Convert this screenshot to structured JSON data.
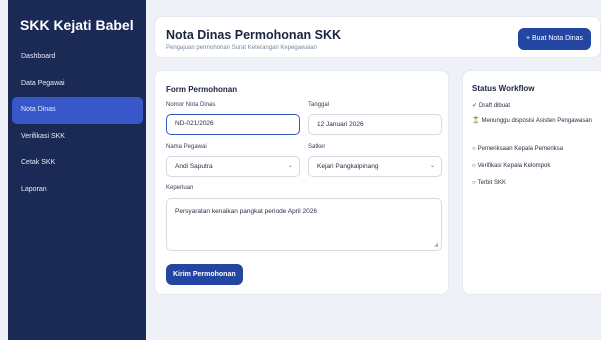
{
  "sidebar": {
    "brand": "SKK Kejati Babel",
    "items": [
      {
        "label": "Dashboard"
      },
      {
        "label": "Data Pegawai"
      },
      {
        "label": "Nota Dinas"
      },
      {
        "label": "Verifikasi SKK"
      },
      {
        "label": "Cetak SKK"
      },
      {
        "label": "Laporan"
      }
    ],
    "active_index": 2
  },
  "header": {
    "title": "Nota Dinas Permohonan SKK",
    "subtitle": "Pengajuan permohonan Surat Keterangan Kepegawaian",
    "new_button": "+ Buat Nota Dinas"
  },
  "form": {
    "title": "Form Permohonan",
    "nomor_label": "Nomor Nota Dinas",
    "nomor_value": "ND-021/2026",
    "tanggal_label": "Tanggal",
    "tanggal_value": "12 Januari 2026",
    "pegawai_label": "Nama Pegawai",
    "pegawai_value": "Andi Saputra",
    "satker_label": "Satker",
    "satker_value": "Kejari Pangkalpinang",
    "keperluan_label": "Keperluan",
    "keperluan_value": "Persyaratan kenaikan pangkat periode April 2026",
    "submit_label": "Kirim Permohonan"
  },
  "workflow": {
    "title": "Status Workflow",
    "steps": [
      {
        "icon": "✓",
        "label": "Draft dibuat",
        "state": "done"
      },
      {
        "icon": "⏳",
        "label": "Menunggu disposisi Asisten Pengawasan",
        "state": "pending"
      },
      {
        "icon": "○",
        "label": "Pemeriksaan Kepala Pemeriksa",
        "state": "todo"
      },
      {
        "icon": "○",
        "label": "Verifikasi Kepala Kelompok",
        "state": "todo"
      },
      {
        "icon": "○",
        "label": "Terbit SKK",
        "state": "todo"
      }
    ]
  },
  "colors": {
    "sidebar_bg": "#1b2a55",
    "active_item": "#3858c9",
    "primary_button": "#2446a3",
    "page_bg": "#eef1f6"
  }
}
